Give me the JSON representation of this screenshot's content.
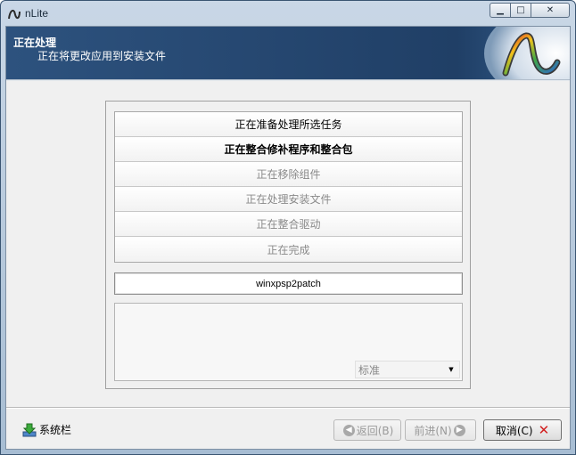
{
  "window": {
    "title": "nLite",
    "controls": {
      "minimize": "▁",
      "maximize": "□",
      "close": "✕"
    }
  },
  "header": {
    "title": "正在处理",
    "subtitle": "正在将更改应用到安装文件"
  },
  "tasks": [
    {
      "label": "正在准备处理所选任务",
      "state": "done"
    },
    {
      "label": "正在整合修补程序和整合包",
      "state": "active"
    },
    {
      "label": "正在移除组件",
      "state": "pending"
    },
    {
      "label": "正在处理安装文件",
      "state": "pending"
    },
    {
      "label": "正在整合驱动",
      "state": "pending"
    },
    {
      "label": "正在完成",
      "state": "pending"
    }
  ],
  "current_item": "winxpsp2patch",
  "priority": {
    "selected": "标准",
    "arrow": "▼"
  },
  "footer": {
    "tray_label": "系统栏",
    "back_label": "返回(B)",
    "next_label": "前进(N)",
    "cancel_label": "取消(C)",
    "back_glyph": "◀",
    "next_glyph": "▶",
    "cancel_glyph": "✕"
  },
  "colors": {
    "header_bg": "#203f66",
    "cancel_x": "#d21f1f"
  }
}
